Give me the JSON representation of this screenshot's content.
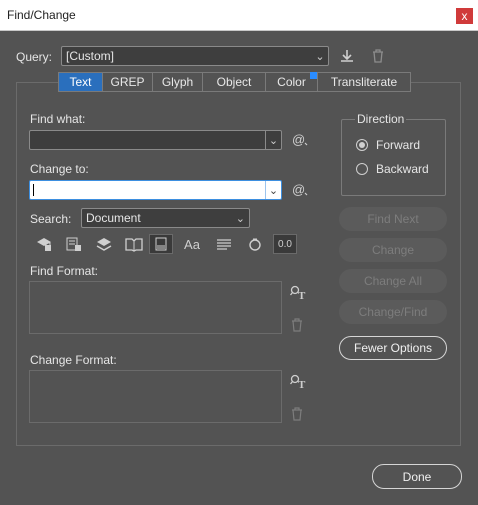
{
  "window": {
    "title": "Find/Change",
    "close_symbol": "x"
  },
  "query": {
    "label": "Query:",
    "value": "[Custom]"
  },
  "tabs": [
    {
      "label": "Text",
      "active": true
    },
    {
      "label": "GREP"
    },
    {
      "label": "Glyph"
    },
    {
      "label": "Object"
    },
    {
      "label": "Color"
    },
    {
      "label": "Transliterate"
    }
  ],
  "find_what": {
    "label": "Find what:",
    "value": ""
  },
  "change_to": {
    "label": "Change to:",
    "value": ""
  },
  "search": {
    "label": "Search:",
    "value": "Document"
  },
  "direction": {
    "label": "Direction",
    "forward": "Forward",
    "backward": "Backward",
    "selected": "Forward"
  },
  "buttons": {
    "find_next": "Find Next",
    "change": "Change",
    "change_all": "Change All",
    "change_find": "Change/Find",
    "fewer_options": "Fewer Options",
    "done": "Done"
  },
  "find_format": {
    "label": "Find Format:"
  },
  "change_format": {
    "label": "Change Format:"
  },
  "option_icons": [
    "include-locked-layers-icon",
    "include-locked-stories-icon",
    "include-hidden-layers-icon",
    "include-master-pages-icon",
    "include-footnotes-icon",
    "case-sensitive-icon",
    "whole-word-icon",
    "kana-sensitive-icon",
    "full-half-width-icon"
  ],
  "colors": {
    "accent": "#2a6fbd",
    "background": "#535353",
    "field": "#3e3e3e"
  }
}
